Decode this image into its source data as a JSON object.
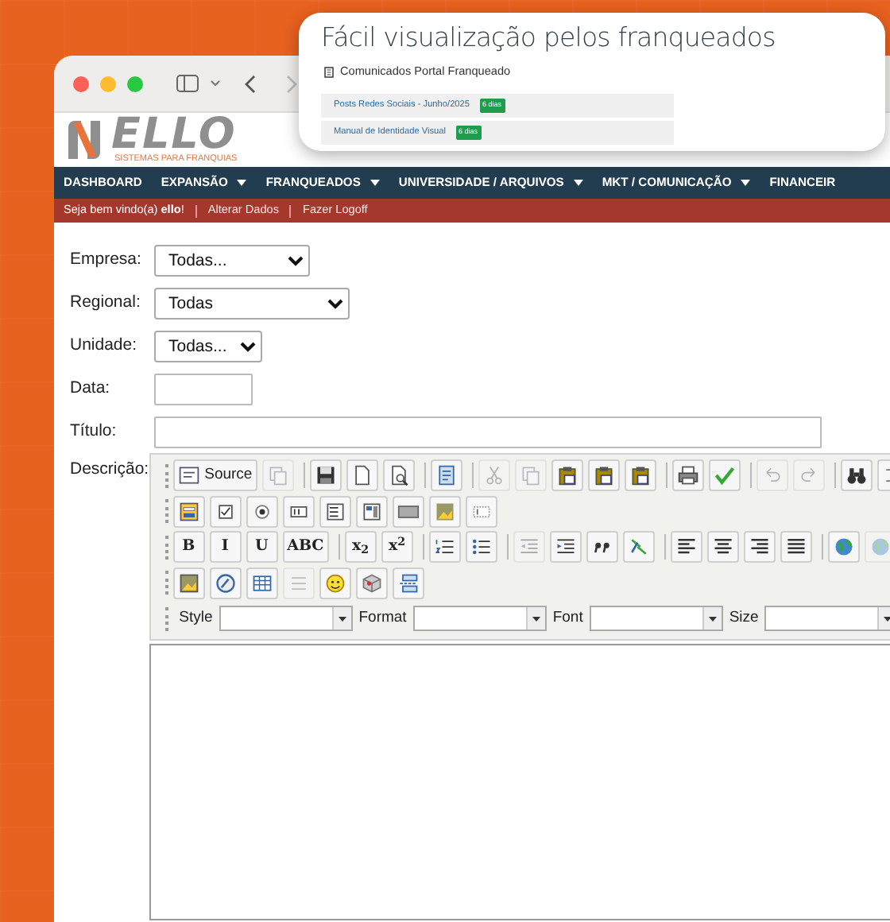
{
  "popup": {
    "title": "Fácil visualização pelos franqueados",
    "section": "Comunicados Portal Franqueado",
    "items": [
      {
        "link": "Posts Redes Sociais - Junho/2025",
        "badge": "6 dias"
      },
      {
        "link": "Manual de Identidade Visual",
        "badge": "6 dias"
      }
    ]
  },
  "browser": {
    "back": {
      "disabled": false
    },
    "forward": {
      "disabled": true
    }
  },
  "logo": {
    "name": "ELLO",
    "tagline": "SISTEMAS PARA FRANQUIAS"
  },
  "nav": [
    {
      "label": "DASHBOARD",
      "has_menu": false
    },
    {
      "label": "EXPANSÃO",
      "has_menu": true
    },
    {
      "label": "FRANQUEADOS",
      "has_menu": true
    },
    {
      "label": "UNIVERSIDADE / ARQUIVOS",
      "has_menu": true
    },
    {
      "label": "MKT / COMUNICAÇÃO",
      "has_menu": true
    },
    {
      "label": "FINANCEIR",
      "has_menu": false
    }
  ],
  "user_bar": [
    {
      "kind": "text",
      "text": "Seja bem vindo(a) **ello**!"
    },
    {
      "kind": "link",
      "text": "Alterar Dados"
    },
    {
      "kind": "link",
      "text": "Fazer Logoff"
    }
  ],
  "form": {
    "fields": [
      {
        "label": "Empresa:",
        "kind": "select",
        "value": "Todas..."
      },
      {
        "label": "Regional:",
        "kind": "select",
        "value": "Todas"
      },
      {
        "label": "Unidade:",
        "kind": "select",
        "value": "Todas..."
      },
      {
        "label": "Data:",
        "kind": "input"
      },
      {
        "label": "Título:",
        "kind": "input"
      }
    ]
  },
  "editor": {
    "label": "Descrição:",
    "toolbar": [
      [
        [
          {
            "label": "Source",
            "disabled": false
          },
          {
            "disabled": true
          }
        ],
        [
          {
            "disabled": false
          },
          {
            "disabled": false
          },
          {
            "disabled": false
          }
        ],
        [
          {
            "disabled": false
          }
        ],
        [
          {
            "disabled": true
          },
          {
            "disabled": true
          },
          {
            "disabled": false
          },
          {
            "disabled": false
          },
          {
            "disabled": false
          }
        ],
        [
          {
            "disabled": false
          },
          {
            "disabled": false
          }
        ],
        [
          {
            "disabled": true
          },
          {
            "disabled": true
          }
        ],
        [
          {
            "disabled": false
          },
          {
            "disabled": false
          }
        ]
      ],
      [
        [
          {
            "disabled": false
          },
          {
            "disabled": false
          },
          {
            "disabled": false
          },
          {
            "disabled": false
          },
          {
            "disabled": false
          },
          {
            "disabled": false
          },
          {
            "disabled": false
          },
          {
            "disabled": false
          },
          {
            "disabled": false
          }
        ]
      ],
      [
        [
          {
            "label": "B",
            "disabled": false
          },
          {
            "label": "I",
            "disabled": false
          },
          {
            "label": "U",
            "disabled": false
          },
          {
            "label": "ABC",
            "disabled": false
          }
        ],
        [
          {
            "label": "x$_{2}$",
            "disabled": false
          },
          {
            "label": "x$^{2}$",
            "disabled": false
          }
        ],
        [
          {
            "disabled": false
          },
          {
            "disabled": false
          }
        ],
        [
          {
            "disabled": true
          },
          {
            "disabled": false
          },
          {
            "disabled": false
          },
          {
            "disabled": false
          }
        ],
        [
          {
            "disabled": false
          },
          {
            "disabled": false
          },
          {
            "disabled": false
          },
          {
            "disabled": false
          }
        ],
        [
          {
            "disabled": false
          },
          {
            "disabled": true
          }
        ]
      ],
      [
        [
          {
            "disabled": false
          },
          {
            "disabled": false
          },
          {
            "disabled": false
          },
          {
            "disabled": true
          },
          {
            "disabled": false
          },
          {
            "disabled": false
          },
          {
            "disabled": false
          }
        ]
      ]
    ],
    "dropdowns": [
      {
        "label": "Style"
      },
      {
        "label": "Format"
      },
      {
        "label": "Font"
      },
      {
        "label": "Size"
      }
    ]
  }
}
